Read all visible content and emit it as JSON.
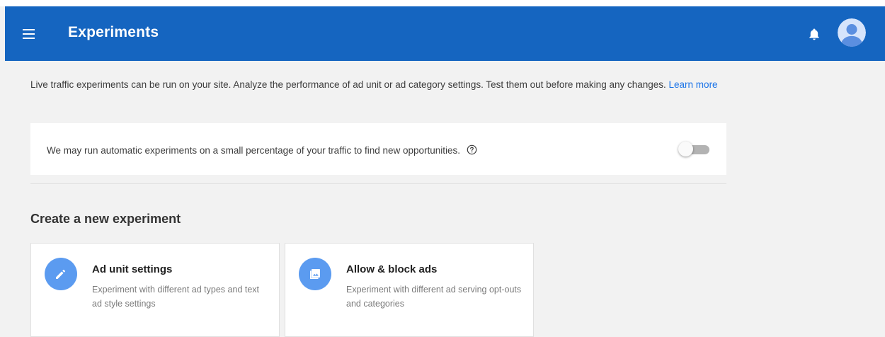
{
  "app_bar": {
    "title": "Experiments",
    "color": "#1565c0",
    "icons": [
      "menu-icon",
      "bell-icon",
      "account-icon"
    ]
  },
  "intro": {
    "text": "Live traffic experiments can be run on your site. Analyze the performance of ad unit or ad category settings. Test them out before making any changes.",
    "link_label": "Learn more"
  },
  "auto_experiments": {
    "text": "We may run automatic experiments on a small percentage of your traffic to find new opportunities.",
    "help_icon": "help-circle-icon",
    "toggle_on": false
  },
  "create_section": {
    "title": "Create a new experiment",
    "cards": [
      {
        "icon": "pencil-icon",
        "title": "Ad unit settings",
        "description": "Experiment with different ad types and text ad style settings"
      },
      {
        "icon": "image-icon",
        "title": "Allow & block ads",
        "description": "Experiment with different ad serving opt-outs and categories"
      }
    ]
  },
  "colors": {
    "accent": "#1565c0",
    "icon_circle": "#5b9bf0",
    "link": "#1a73e8",
    "background": "#f2f2f2"
  }
}
